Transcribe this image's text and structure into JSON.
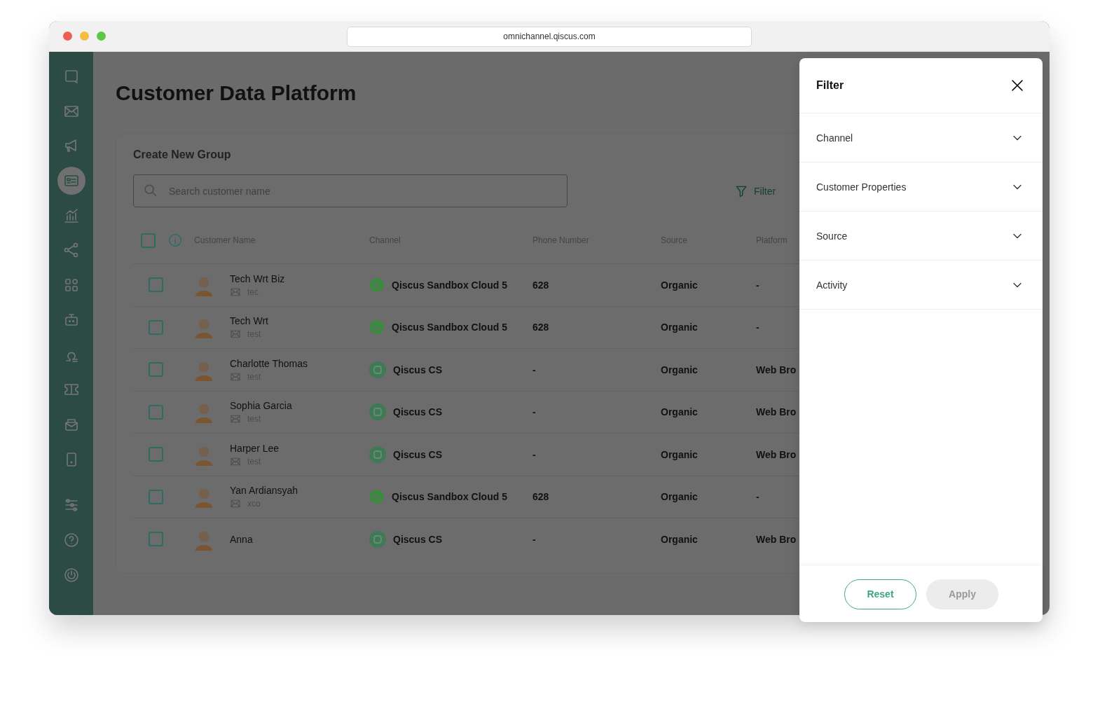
{
  "browser": {
    "url": "omnichannel.qiscus.com"
  },
  "sidebar": {
    "items": [
      {
        "selected": false
      },
      {
        "selected": false
      },
      {
        "selected": false
      },
      {
        "selected": true
      },
      {
        "selected": false
      },
      {
        "selected": false
      },
      {
        "selected": false
      },
      {
        "selected": false
      },
      {
        "selected": false
      },
      {
        "selected": false
      },
      {
        "selected": false
      },
      {
        "selected": false
      },
      {
        "selected": false
      },
      {
        "selected": false
      },
      {
        "selected": false
      }
    ]
  },
  "page": {
    "title": "Customer Data Platform"
  },
  "card": {
    "title": "Create New Group",
    "search": {
      "placeholder": "Search customer name"
    },
    "filter_button": "Filter"
  },
  "table": {
    "all_checked": false,
    "columns": [
      "Customer Name",
      "Channel",
      "Phone Number",
      "Source",
      "Platform"
    ],
    "rows": [
      {
        "checked": false,
        "name": "Tech Wrt Biz",
        "email": "tec",
        "kind": "whatsapp",
        "channel": "Qiscus Sandbox Cloud 5",
        "phone": "628",
        "source": "Organic",
        "platform": "-"
      },
      {
        "checked": false,
        "name": "Tech Wrt",
        "email": "test",
        "kind": "whatsapp",
        "channel": "Qiscus Sandbox Cloud 5",
        "phone": "628",
        "source": "Organic",
        "platform": "-"
      },
      {
        "checked": false,
        "name": "Charlotte Thomas",
        "email": "test",
        "kind": "qiscus",
        "channel": "Qiscus CS",
        "phone": "-",
        "source": "Organic",
        "platform": "Web Bro"
      },
      {
        "checked": false,
        "name": "Sophia Garcia",
        "email": "test",
        "kind": "qiscus",
        "channel": "Qiscus CS",
        "phone": "-",
        "source": "Organic",
        "platform": "Web Bro"
      },
      {
        "checked": false,
        "name": "Harper Lee",
        "email": "test",
        "kind": "qiscus",
        "channel": "Qiscus CS",
        "phone": "-",
        "source": "Organic",
        "platform": "Web Bro"
      },
      {
        "checked": false,
        "name": "Yan Ardiansyah",
        "email": "xco",
        "kind": "whatsapp",
        "channel": "Qiscus Sandbox Cloud 5",
        "phone": "628",
        "source": "Organic",
        "platform": "-"
      },
      {
        "checked": false,
        "name": "Anna",
        "kind": "qiscus",
        "channel": "Qiscus CS",
        "phone": "-",
        "source": "Organic",
        "platform": "Web Bro"
      }
    ]
  },
  "filter_panel": {
    "title": "Filter",
    "sections": [
      "Channel",
      "Customer Properties",
      "Source",
      "Activity"
    ],
    "buttons": [
      {
        "label": "Reset",
        "kind": "outline"
      },
      {
        "label": "Apply",
        "kind": "disabled"
      }
    ]
  }
}
